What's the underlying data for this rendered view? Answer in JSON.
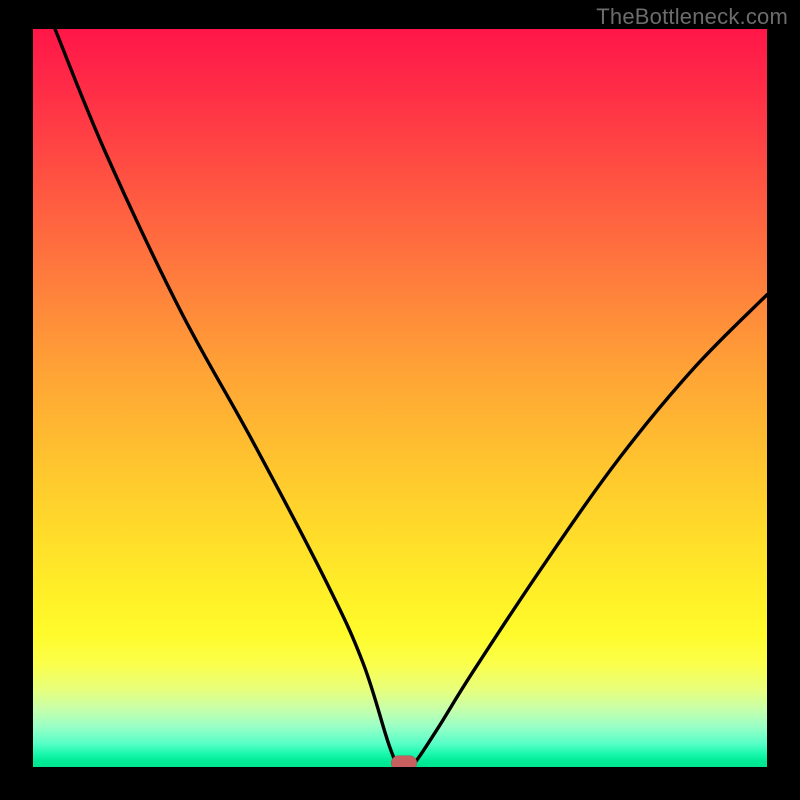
{
  "watermark": "TheBottleneck.com",
  "chart_data": {
    "type": "line",
    "title": "",
    "xlabel": "",
    "ylabel": "",
    "xlim": [
      0,
      100
    ],
    "ylim": [
      0,
      100
    ],
    "series": [
      {
        "name": "bottleneck-curve",
        "x": [
          3,
          10,
          20,
          30,
          40,
          45,
          48.5,
          50,
          51.5,
          55,
          60,
          70,
          80,
          90,
          100
        ],
        "values": [
          100,
          83,
          62,
          44,
          25,
          14,
          3,
          0,
          0,
          5,
          13,
          28,
          42,
          54,
          64
        ]
      }
    ],
    "marker": {
      "x": 50.5,
      "y": 0
    },
    "gradient_stops": [
      {
        "pos": 0,
        "color": "#ff1648"
      },
      {
        "pos": 50,
        "color": "#ffb533"
      },
      {
        "pos": 82,
        "color": "#fffb2b"
      },
      {
        "pos": 100,
        "color": "#00e48e"
      }
    ]
  }
}
